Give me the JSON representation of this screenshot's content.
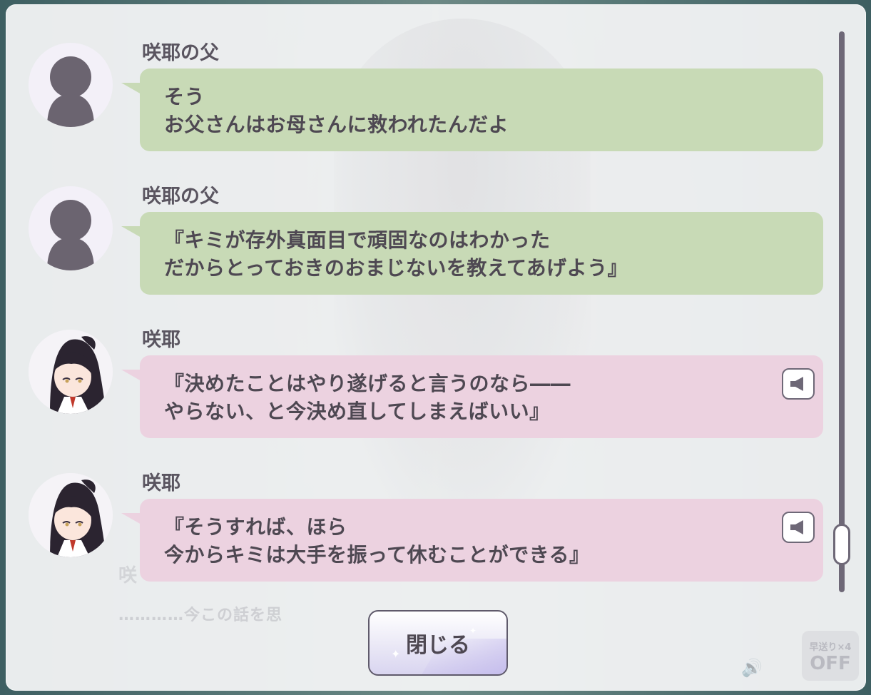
{
  "entries": [
    {
      "speaker": "咲耶の父",
      "avatar": "silhouette-avatar",
      "bubble_color": "#c8dab6",
      "line1": "そう",
      "line2": "お父さんはお母さんに救われたんだよ",
      "has_voice": false
    },
    {
      "speaker": "咲耶の父",
      "avatar": "silhouette-avatar",
      "bubble_color": "#c8dab6",
      "line1": "『キミが存外真面目で頑固なのはわかった",
      "line2": "だからとっておきのおまじないを教えてあげよう』",
      "has_voice": false
    },
    {
      "speaker": "咲耶",
      "avatar": "character-avatar",
      "bubble_color": "#ecd2e0",
      "line1": "『決めたことはやり遂げると言うのなら――",
      "line2": "やらない、と今決め直してしまえばいい』",
      "has_voice": true
    },
    {
      "speaker": "咲耶",
      "avatar": "character-avatar",
      "bubble_color": "#ecd2e0",
      "line1": "『そうすれば、ほら",
      "line2": "今からキミは大手を振って休むことができる』",
      "has_voice": true
    }
  ],
  "close_button": {
    "label": "閉じる"
  },
  "background": {
    "ghost_name": "咲",
    "ghost_text": "…………今この話を思",
    "fast_forward_label": "早送り×4",
    "fast_forward_state": "OFF"
  },
  "colors": {
    "speaker_green": "#c8dab6",
    "speaker_pink": "#ecd2e0",
    "text": "#4e4852",
    "scrollbar": "#6e6877"
  }
}
